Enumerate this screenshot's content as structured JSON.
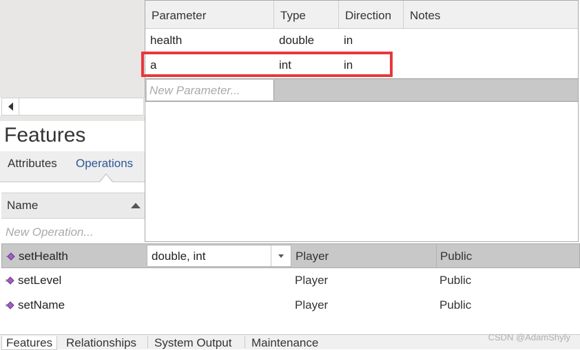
{
  "param_table": {
    "headers": [
      "Parameter",
      "Type",
      "Direction",
      "Notes"
    ],
    "rows": [
      {
        "parameter": "health",
        "type": "double",
        "direction": "in",
        "notes": ""
      },
      {
        "parameter": "a",
        "type": "int",
        "direction": "in",
        "notes": ""
      }
    ],
    "new_placeholder": "New Parameter..."
  },
  "features": {
    "title": "Features",
    "tabs": [
      "Attributes",
      "Operations"
    ],
    "active_tab": "Operations",
    "column_name": "Name",
    "new_placeholder": "New Operation..."
  },
  "operations": [
    {
      "name": "setHealth",
      "params": "double, int",
      "class": "Player",
      "scope": "Public",
      "selected": true
    },
    {
      "name": "setLevel",
      "params": "",
      "class": "Player",
      "scope": "Public",
      "selected": false
    },
    {
      "name": "setName",
      "params": "",
      "class": "Player",
      "scope": "Public",
      "selected": false
    }
  ],
  "bottom_tabs": [
    "Features",
    "Relationships",
    "System Output",
    "Maintenance"
  ],
  "active_bottom_tab": "Features",
  "watermark": "CSDN @AdamShyly",
  "colors": {
    "highlight": "#e8373b",
    "active_tab_text": "#2b5797",
    "selected_row": "#c8c8c8",
    "operation_icon": "#a060c0"
  },
  "icons": {
    "operation": "operation-method-icon",
    "sort": "sort-ascending-icon",
    "dropdown": "chevron-down-icon",
    "scroll_left": "scroll-left-arrow-icon"
  }
}
